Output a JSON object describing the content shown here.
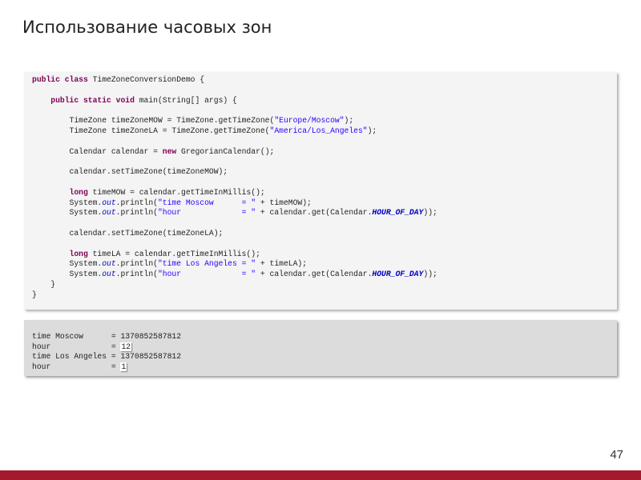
{
  "slide": {
    "title": "Использование часовых зон",
    "page_number": "47",
    "accent_color": "#a5192e"
  },
  "code": [
    [
      [
        "public class",
        "kw"
      ],
      [
        " TimeZoneConversionDemo {",
        ""
      ]
    ],
    [],
    [
      [
        "    ",
        ""
      ],
      [
        "public static void",
        "kw"
      ],
      [
        " main(String[] args) {",
        ""
      ]
    ],
    [],
    [
      [
        "        TimeZone timeZoneMOW = TimeZone.getTimeZone(",
        ""
      ],
      [
        "\"Europe/Moscow\"",
        "str"
      ],
      [
        ");",
        ""
      ]
    ],
    [
      [
        "        TimeZone timeZoneLA = TimeZone.getTimeZone(",
        ""
      ],
      [
        "\"America/Los_Angeles\"",
        "str"
      ],
      [
        ");",
        ""
      ]
    ],
    [],
    [
      [
        "        Calendar calendar = ",
        ""
      ],
      [
        "new",
        "kw"
      ],
      [
        " GregorianCalendar();",
        ""
      ]
    ],
    [],
    [
      [
        "        calendar.setTimeZone(timeZoneMOW);",
        ""
      ]
    ],
    [],
    [
      [
        "        ",
        ""
      ],
      [
        "long",
        "kw"
      ],
      [
        " timeMOW = calendar.getTimeInMillis();",
        ""
      ]
    ],
    [
      [
        "        System.",
        ""
      ],
      [
        "out",
        "fld"
      ],
      [
        ".println(",
        ""
      ],
      [
        "\"time Moscow      = \"",
        "str"
      ],
      [
        " + timeMOW);",
        ""
      ]
    ],
    [
      [
        "        System.",
        ""
      ],
      [
        "out",
        "fld"
      ],
      [
        ".println(",
        ""
      ],
      [
        "\"hour             = \"",
        "str"
      ],
      [
        " + calendar.get(Calendar.",
        ""
      ],
      [
        "HOUR_OF_DAY",
        "cst"
      ],
      [
        "));",
        ""
      ]
    ],
    [],
    [
      [
        "        calendar.setTimeZone(timeZoneLA);",
        ""
      ]
    ],
    [],
    [
      [
        "        ",
        ""
      ],
      [
        "long",
        "kw"
      ],
      [
        " timeLA = calendar.getTimeInMillis();",
        ""
      ]
    ],
    [
      [
        "        System.",
        ""
      ],
      [
        "out",
        "fld"
      ],
      [
        ".println(",
        ""
      ],
      [
        "\"time Los Angeles = \"",
        "str"
      ],
      [
        " + timeLA);",
        ""
      ]
    ],
    [
      [
        "        System.",
        ""
      ],
      [
        "out",
        "fld"
      ],
      [
        ".println(",
        ""
      ],
      [
        "\"hour             = \"",
        "str"
      ],
      [
        " + calendar.get(Calendar.",
        ""
      ],
      [
        "HOUR_OF_DAY",
        "cst"
      ],
      [
        "));",
        ""
      ]
    ],
    [
      [
        "    }",
        ""
      ]
    ],
    [
      [
        "}",
        ""
      ]
    ]
  ],
  "output": [
    {
      "label": "time Moscow      = ",
      "value": "1370852587812",
      "highlight": false
    },
    {
      "label": "hour             = ",
      "value": "12",
      "highlight": true
    },
    {
      "label": "time Los Angeles = ",
      "value": "1370852587812",
      "highlight": false
    },
    {
      "label": "hour             = ",
      "value": "1",
      "highlight": true
    }
  ]
}
